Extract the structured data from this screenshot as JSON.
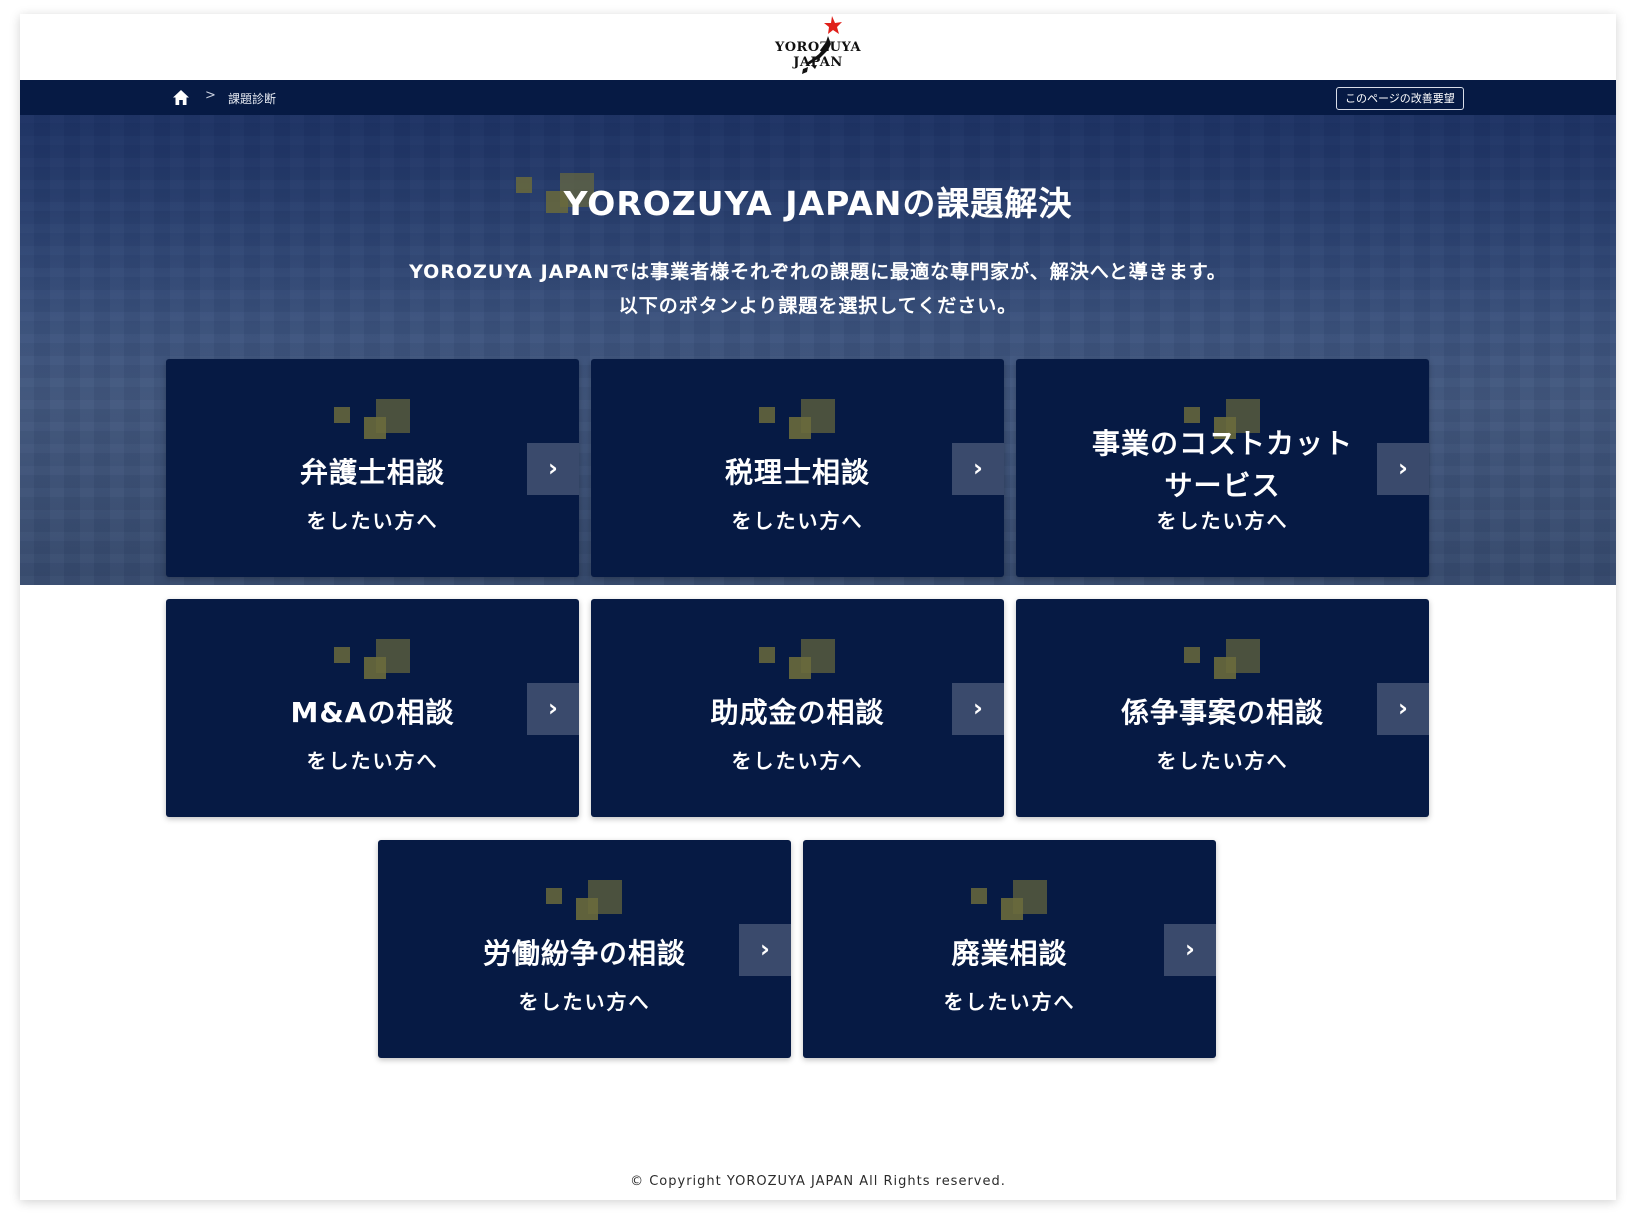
{
  "brand": {
    "logo_text": "YOROZUYA JAPAN"
  },
  "breadcrumb": {
    "separator": ">",
    "current": "課題診断"
  },
  "toolbar": {
    "improve_label": "このページの改善要望"
  },
  "hero": {
    "title": "YOROZUYA JAPANの課題解決",
    "description_line1": "YOROZUYA JAPANでは事業者様それぞれの課題に最適な専門家が、解決へと導きます。",
    "description_line2": "以下のボタンより課題を選択してください。"
  },
  "cards": [
    {
      "title": "弁護士相談",
      "subtitle": "をしたい方へ",
      "arrow": "›"
    },
    {
      "title": "税理士相談",
      "subtitle": "をしたい方へ",
      "arrow": "›"
    },
    {
      "title_line1": "事業のコストカット",
      "title_line2": "サービス",
      "subtitle": "をしたい方へ",
      "arrow": "›"
    },
    {
      "title": "M&Aの相談",
      "subtitle": "をしたい方へ",
      "arrow": "›"
    },
    {
      "title": "助成金の相談",
      "subtitle": "をしたい方へ",
      "arrow": "›"
    },
    {
      "title": "係争事案の相談",
      "subtitle": "をしたい方へ",
      "arrow": "›"
    },
    {
      "title": "労働紛争の相談",
      "subtitle": "をしたい方へ",
      "arrow": "›"
    },
    {
      "title": "廃業相談",
      "subtitle": "をしたい方へ",
      "arrow": "›"
    }
  ],
  "footer": {
    "copyright": "© Copyright YOROZUYA JAPAN All Rights reserved."
  },
  "colors": {
    "navy": "#061a44",
    "arrow_bg": "#3a4a6c",
    "deco_gold": "#6a6a3c",
    "logo_red": "#e0201a"
  }
}
